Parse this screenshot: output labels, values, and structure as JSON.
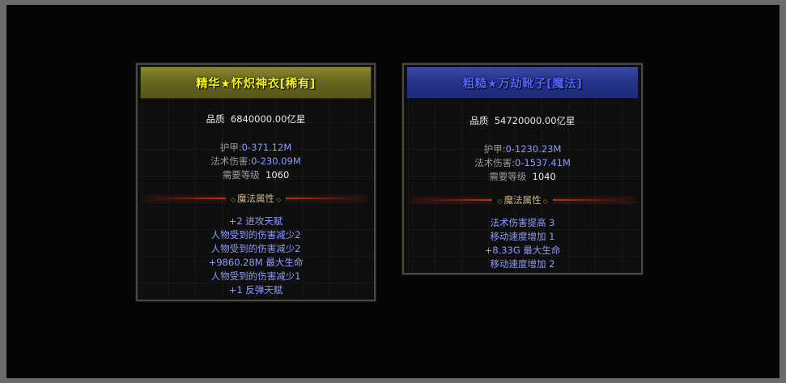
{
  "items": [
    {
      "name": "精华★怀炽神衣[稀有]",
      "quality_label": "品质",
      "quality_value": "6840000.00亿星",
      "stats": [
        {
          "label": "护甲:",
          "value": "0-371.12M"
        },
        {
          "label": "法术伤害:",
          "value": "0-230.09M"
        }
      ],
      "level_label": "需要等级",
      "level_value": "1060",
      "section_title": "魔法属性",
      "attributes": [
        "+2 进攻天赋",
        "人物受到的伤害减少2",
        "人物受到的伤害减少2",
        "+9860.28M 最大生命",
        "人物受到的伤害减少1",
        "+1 反弹天赋"
      ]
    },
    {
      "name": "粗糙★万劫靴子[魔法]",
      "quality_label": "品质",
      "quality_value": "54720000.00亿星",
      "stats": [
        {
          "label": "护甲:",
          "value": "0-1230.23M"
        },
        {
          "label": "法术伤害:",
          "value": "0-1537.41M"
        }
      ],
      "level_label": "需要等级",
      "level_value": "1040",
      "section_title": "魔法属性",
      "attributes": [
        "法术伤害提高 3",
        "移动速度增加 1",
        "+8.33G 最大生命",
        "移动速度增加 2"
      ]
    }
  ],
  "colors": {
    "rare_title": "#f5f515",
    "magic_title": "#4e63ff",
    "attribute_text": "#8c9bff",
    "stat_label": "#9a9a9a",
    "stat_value": "#8c9bff"
  }
}
